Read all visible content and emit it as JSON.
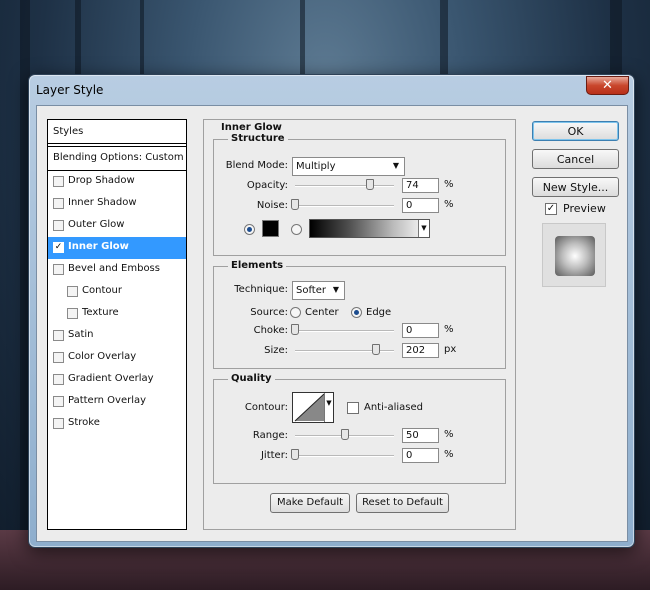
{
  "window": {
    "title": "Layer Style",
    "close_glyph": "✕"
  },
  "styles_panel": {
    "header": "Styles",
    "blending_options": "Blending Options: Custom",
    "items": [
      {
        "label": "Drop Shadow",
        "checked": false,
        "sub": false,
        "selected": false
      },
      {
        "label": "Inner Shadow",
        "checked": false,
        "sub": false,
        "selected": false
      },
      {
        "label": "Outer Glow",
        "checked": false,
        "sub": false,
        "selected": false
      },
      {
        "label": "Inner Glow",
        "checked": true,
        "sub": false,
        "selected": true
      },
      {
        "label": "Bevel and Emboss",
        "checked": false,
        "sub": false,
        "selected": false
      },
      {
        "label": "Contour",
        "checked": false,
        "sub": true,
        "selected": false
      },
      {
        "label": "Texture",
        "checked": false,
        "sub": true,
        "selected": false
      },
      {
        "label": "Satin",
        "checked": false,
        "sub": false,
        "selected": false
      },
      {
        "label": "Color Overlay",
        "checked": false,
        "sub": false,
        "selected": false
      },
      {
        "label": "Gradient Overlay",
        "checked": false,
        "sub": false,
        "selected": false
      },
      {
        "label": "Pattern Overlay",
        "checked": false,
        "sub": false,
        "selected": false
      },
      {
        "label": "Stroke",
        "checked": false,
        "sub": false,
        "selected": false
      }
    ]
  },
  "inner_glow": {
    "title": "Inner Glow",
    "structure": {
      "title": "Structure",
      "blend_mode_label": "Blend Mode:",
      "blend_mode_value": "Multiply",
      "opacity_label": "Opacity:",
      "opacity_value": "74",
      "noise_label": "Noise:",
      "noise_value": "0",
      "percent": "%",
      "color_mode": "solid",
      "glow_color": "#000000"
    },
    "elements": {
      "title": "Elements",
      "technique_label": "Technique:",
      "technique_value": "Softer",
      "source_label": "Source:",
      "source_center": "Center",
      "source_edge": "Edge",
      "source_selected": "Edge",
      "choke_label": "Choke:",
      "choke_value": "0",
      "size_label": "Size:",
      "size_value": "202",
      "px": "px"
    },
    "quality": {
      "title": "Quality",
      "contour_label": "Contour:",
      "anti_aliased_label": "Anti-aliased",
      "anti_aliased_checked": false,
      "range_label": "Range:",
      "range_value": "50",
      "jitter_label": "Jitter:",
      "jitter_value": "0"
    },
    "make_default": "Make Default",
    "reset_default": "Reset to Default"
  },
  "right_buttons": {
    "ok": "OK",
    "cancel": "Cancel",
    "new_style": "New Style...",
    "preview_label": "Preview",
    "preview_checked": true
  }
}
